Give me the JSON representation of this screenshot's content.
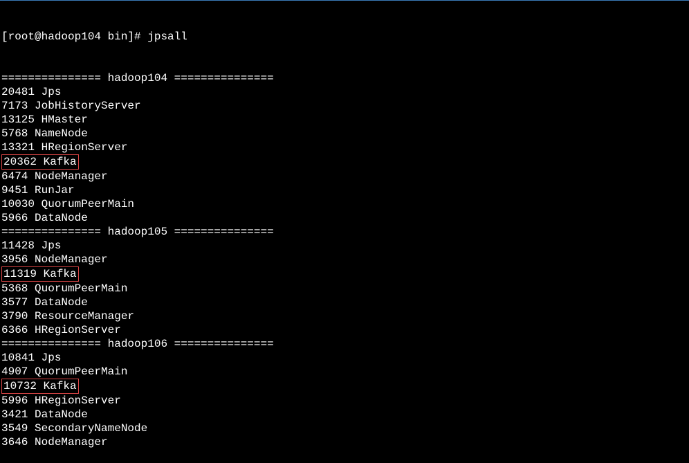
{
  "prompt": "[root@hadoop104 bin]# ",
  "command": "jpsall",
  "separator_prefix": "=============== ",
  "separator_suffix": " ===============",
  "hosts": [
    {
      "name": "hadoop104",
      "processes": [
        {
          "pid": "20481",
          "name": "Jps",
          "highlight": false
        },
        {
          "pid": "7173",
          "name": "JobHistoryServer",
          "highlight": false
        },
        {
          "pid": "13125",
          "name": "HMaster",
          "highlight": false
        },
        {
          "pid": "5768",
          "name": "NameNode",
          "highlight": false
        },
        {
          "pid": "13321",
          "name": "HRegionServer",
          "highlight": false
        },
        {
          "pid": "20362",
          "name": "Kafka",
          "highlight": true
        },
        {
          "pid": "6474",
          "name": "NodeManager",
          "highlight": false
        },
        {
          "pid": "9451",
          "name": "RunJar",
          "highlight": false
        },
        {
          "pid": "10030",
          "name": "QuorumPeerMain",
          "highlight": false
        },
        {
          "pid": "5966",
          "name": "DataNode",
          "highlight": false
        }
      ]
    },
    {
      "name": "hadoop105",
      "processes": [
        {
          "pid": "11428",
          "name": "Jps",
          "highlight": false
        },
        {
          "pid": "3956",
          "name": "NodeManager",
          "highlight": false
        },
        {
          "pid": "11319",
          "name": "Kafka",
          "highlight": true
        },
        {
          "pid": "5368",
          "name": "QuorumPeerMain",
          "highlight": false
        },
        {
          "pid": "3577",
          "name": "DataNode",
          "highlight": false
        },
        {
          "pid": "3790",
          "name": "ResourceManager",
          "highlight": false
        },
        {
          "pid": "6366",
          "name": "HRegionServer",
          "highlight": false
        }
      ]
    },
    {
      "name": "hadoop106",
      "processes": [
        {
          "pid": "10841",
          "name": "Jps",
          "highlight": false
        },
        {
          "pid": "4907",
          "name": "QuorumPeerMain",
          "highlight": false
        },
        {
          "pid": "10732",
          "name": "Kafka",
          "highlight": true
        },
        {
          "pid": "5996",
          "name": "HRegionServer",
          "highlight": false
        },
        {
          "pid": "3421",
          "name": "DataNode",
          "highlight": false
        },
        {
          "pid": "3549",
          "name": "SecondaryNameNode",
          "highlight": false
        },
        {
          "pid": "3646",
          "name": "NodeManager",
          "highlight": false
        }
      ]
    }
  ]
}
